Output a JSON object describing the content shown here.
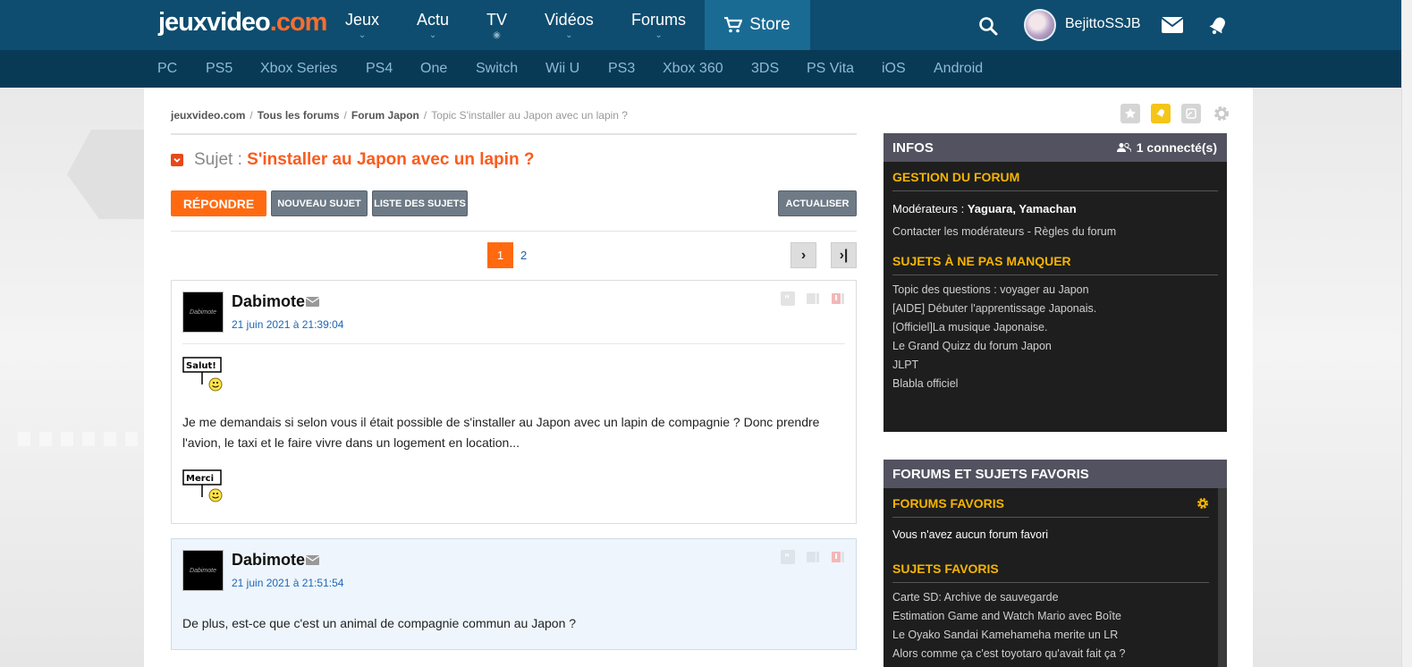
{
  "header": {
    "logo_main": "jeuxvideo",
    "logo_suffix": ".com",
    "nav": [
      {
        "label": "Jeux",
        "marker": "⌄"
      },
      {
        "label": "Actu",
        "marker": "⌄"
      },
      {
        "label": "TV",
        "marker": "◉"
      },
      {
        "label": "Vidéos",
        "marker": "⌄"
      },
      {
        "label": "Forums",
        "marker": "⌄"
      }
    ],
    "store_label": "Store",
    "username": "BejittoSSJB"
  },
  "platforms": [
    "PC",
    "PS5",
    "Xbox Series",
    "PS4",
    "One",
    "Switch",
    "Wii U",
    "PS3",
    "Xbox 360",
    "3DS",
    "PS Vita",
    "iOS",
    "Android"
  ],
  "breadcrumb": {
    "items": [
      "jeuxvideo.com",
      "Tous les forums",
      "Forum Japon"
    ],
    "current": "Topic S'installer au Japon avec un lapin ?",
    "separator": "/"
  },
  "topic": {
    "subject_label": "Sujet :",
    "title": "S'installer au Japon avec un lapin ?"
  },
  "toolbar": {
    "reply": "Répondre",
    "new_topic": "Nouveau sujet",
    "topic_list": "Liste des sujets",
    "refresh": "Actualiser"
  },
  "pagination": {
    "current": "1",
    "next_page": "2",
    "next_icon": "›",
    "last_icon": "›|"
  },
  "posts": [
    {
      "author": "Dabimote",
      "avatar_text": "Dabimote",
      "date": "21 juin 2021 à 21:39:04",
      "smiley_top": "Salut!",
      "text": "Je me demandais si selon vous il était possible de s'installer au Japon avec un lapin de compagnie ? Donc prendre l'avion, le taxi et le faire vivre dans un logement en location...",
      "smiley_bottom": "Merci"
    },
    {
      "author": "Dabimote",
      "avatar_text": "Dabimote",
      "date": "21 juin 2021 à 21:51:54",
      "text": "De plus, est-ce que c'est un animal de compagnie commun au Japon ?"
    }
  ],
  "sidebar": {
    "infos": {
      "title": "Infos",
      "connected": "1 connecté(s)",
      "gestion_title": "Gestion du forum",
      "moderators_label": "Modérateurs :",
      "moderators": "Yaguara, Yamachan",
      "links": "Contacter les modérateurs - Règles du forum",
      "must_see_title": "Sujets à ne pas manquer",
      "must_see": [
        "Topic des questions : voyager au Japon",
        "[AIDE] Débuter l'apprentissage Japonais.",
        "[Officiel]La musique Japonaise.",
        "Le Grand Quizz du forum Japon",
        "JLPT",
        "Blabla officiel"
      ]
    },
    "favorites": {
      "title": "Forums et sujets favoris",
      "forums_title": "Forums favoris",
      "no_forum": "Vous n'avez aucun forum favori",
      "topics_title": "Sujets favoris",
      "topics": [
        "Carte SD: Archive de sauvegarde",
        "Estimation Game and Watch Mario avec Boîte",
        "Le Oyako Sandai Kamehameha merite un LR",
        "Alors comme ça c'est toyotaro qu'avait fait ça ?"
      ]
    }
  },
  "colors": {
    "accent": "#ff6a11",
    "nav_bg": "#0e4d6f",
    "subnav_bg": "#083a56",
    "sidebar_yellow": "#f5b400"
  }
}
